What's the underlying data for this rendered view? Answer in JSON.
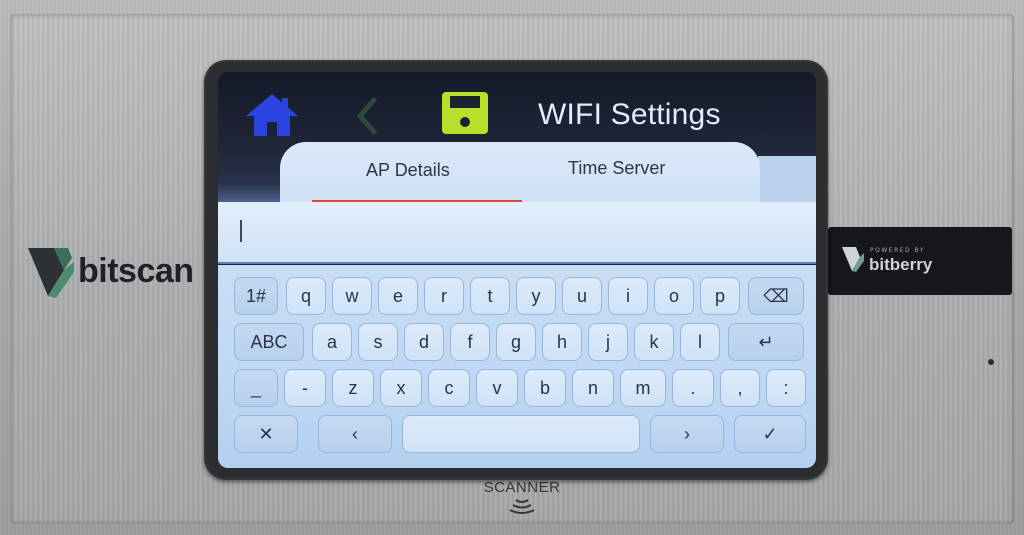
{
  "device": {
    "brand_left": "bitscan",
    "badge_powered_by": "POWERED BY",
    "badge_brand": "bitberry",
    "scanner_label": "SCANNER"
  },
  "screen": {
    "title": "WIFI Settings",
    "icons": {
      "home": "home-icon",
      "back": "chevron-left-icon",
      "save": "floppy-disk-icon"
    },
    "colors": {
      "home": "#2b44e0",
      "save": "#b8e02a",
      "tab_underline": "#d54a3c"
    },
    "tabs": [
      {
        "label": "AP Details",
        "active": true
      },
      {
        "label": "Time Server",
        "active": false
      }
    ],
    "input": {
      "value": ""
    }
  },
  "keyboard": {
    "row1": [
      "1#",
      "q",
      "w",
      "e",
      "r",
      "t",
      "y",
      "u",
      "i",
      "o",
      "p",
      "⌫"
    ],
    "row2": [
      "ABC",
      "a",
      "s",
      "d",
      "f",
      "g",
      "h",
      "j",
      "k",
      "l",
      "↵"
    ],
    "row3": [
      "_",
      "-",
      "z",
      "x",
      "c",
      "v",
      "b",
      "n",
      "m",
      ".",
      ",",
      ":"
    ],
    "row4": [
      "✕",
      "‹",
      "",
      "›",
      "✓"
    ]
  }
}
